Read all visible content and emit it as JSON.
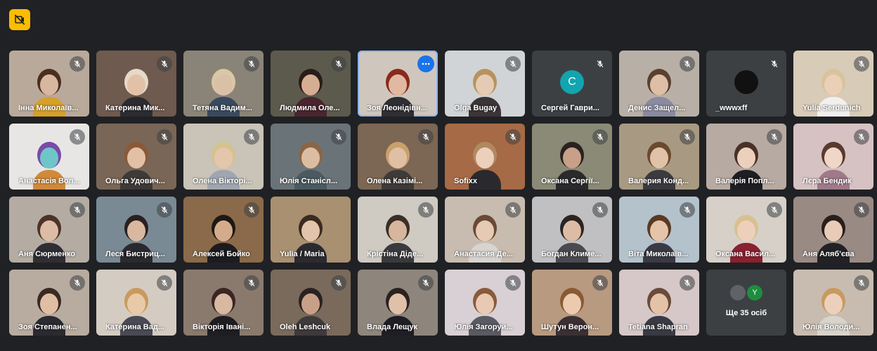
{
  "top_button_icon": "no-video-icon",
  "colors": {
    "background": "#202124",
    "tile": "#3c4043",
    "accent": "#8ab4f8",
    "button": "#fbbc04"
  },
  "participants": [
    {
      "name": "Інна Миколаїв...",
      "muted": true,
      "bg": "#b9a99a",
      "skin": "#d8b7a0",
      "hair": "#4a2e20",
      "shirt": "#d6a02a"
    },
    {
      "name": "Катерина Мик...",
      "muted": true,
      "bg": "#6e5a4e",
      "skin": "#e2c1a9",
      "hair": "#e6d9c8",
      "shirt": "#2c2c30"
    },
    {
      "name": "Тетяна Вадим...",
      "muted": true,
      "bg": "#8a8478",
      "skin": "#d9c0a6",
      "hair": "#d9c8a4",
      "shirt": "#3a4a5e"
    },
    {
      "name": "Людмила Оле...",
      "muted": true,
      "bg": "#5c5a4c",
      "skin": "#d4ad92",
      "hair": "#2a1c18",
      "shirt": "#4a2530"
    },
    {
      "name": "Зоя Леонідівн...",
      "muted": false,
      "active": true,
      "bg": "#cfc7bd",
      "skin": "#e0b9a0",
      "hair": "#8a2a1c",
      "shirt": "#2e2e34"
    },
    {
      "name": "Olga Bugay",
      "muted": true,
      "bg": "#d1d4d6",
      "skin": "#e6cbb4",
      "hair": "#b8925e",
      "shirt": "#3c3436"
    },
    {
      "name": "Сергей Гаври...",
      "muted": true,
      "avatar": "C",
      "avatar_color": "#12a4af"
    },
    {
      "name": "Денис Защел...",
      "muted": true,
      "bg": "#b8b0a6",
      "skin": "#dcbfa6",
      "hair": "#5a4030",
      "shirt": "#8a8aa0"
    },
    {
      "name": "_wwwxff",
      "muted": true,
      "avatar": "",
      "avatar_color": "#111111"
    },
    {
      "name": "Yulia Serdunich",
      "muted": true,
      "bg": "#d8cbb8",
      "skin": "#ebcfb6",
      "hair": "#d8c39c",
      "shirt": "#f2f0ee"
    },
    {
      "name": "Анастасія Вол...",
      "muted": true,
      "bg": "#e8e6e4",
      "skin": "#6ec6c8",
      "hair": "#7a4aa8",
      "shirt": "#d08a3a"
    },
    {
      "name": "Ольга Удович...",
      "muted": true,
      "bg": "#7a6656",
      "skin": "#e2c0a6",
      "hair": "#8a5a38",
      "shirt": "#3e3a38"
    },
    {
      "name": "Олена Вікторі...",
      "muted": true,
      "bg": "#c9c3b8",
      "skin": "#e4c6ad",
      "hair": "#d6c28e",
      "shirt": "#a0a6b0"
    },
    {
      "name": "Юлія Станісл...",
      "muted": true,
      "bg": "#6a7478",
      "skin": "#ddbda2",
      "hair": "#8a6646",
      "shirt": "#4a5a60"
    },
    {
      "name": "Олена Казімі...",
      "muted": true,
      "bg": "#7c6654",
      "skin": "#e0c0a4",
      "hair": "#c8a06a",
      "shirt": "#3e3a38"
    },
    {
      "name": "Sofixx",
      "muted": true,
      "bg": "#a66a46",
      "skin": "#ecd0bc",
      "hair": "#b08a5e",
      "shirt": "#2a2a2e"
    },
    {
      "name": "Оксана Сергії...",
      "muted": true,
      "bg": "#8a8a76",
      "skin": "#c8a088",
      "hair": "#2a2220",
      "shirt": "#2a2a2c"
    },
    {
      "name": "Валерия Конд...",
      "muted": true,
      "bg": "#a89a82",
      "skin": "#e0c2a8",
      "hair": "#6a4a2e",
      "shirt": "#3a3a40"
    },
    {
      "name": "Валерія Попл...",
      "muted": true,
      "bg": "#b6aaa2",
      "skin": "#ebd0bc",
      "hair": "#4a3026",
      "shirt": "#1e1e22"
    },
    {
      "name": "Лєра Бендик",
      "muted": true,
      "bg": "#d6c2c2",
      "skin": "#f0d6c6",
      "hair": "#5a3a2e",
      "shirt": "#a07a8a"
    },
    {
      "name": "Аня Сюрменко",
      "muted": true,
      "bg": "#b4aca2",
      "skin": "#dcbca4",
      "hair": "#4a3428",
      "shirt": "#2e2e34"
    },
    {
      "name": "Леся Бистриц...",
      "muted": true,
      "bg": "#7a8a94",
      "skin": "#d9b8a0",
      "hair": "#2a2020",
      "shirt": "#2a2a2e"
    },
    {
      "name": "Алексей Бойко",
      "muted": true,
      "bg": "#8a6a4a",
      "skin": "#d4ac8c",
      "hair": "#1e1814",
      "shirt": "#1c1c20"
    },
    {
      "name": "Yulia / Maria",
      "muted": false,
      "bg": "#a89070",
      "skin": "#e2c4aa",
      "hair": "#3a2a20",
      "shirt": "#2a2a30"
    },
    {
      "name": "Крістіна Діде...",
      "muted": true,
      "bg": "#cfcac2",
      "skin": "#d6b69c",
      "hair": "#3a2e28",
      "shirt": "#3a3a3e"
    },
    {
      "name": "Анастасия Де...",
      "muted": true,
      "bg": "#c8bcb0",
      "skin": "#e6cab4",
      "hair": "#6a4a34",
      "shirt": "#d8d4d0"
    },
    {
      "name": "Богдан Климе...",
      "muted": true,
      "bg": "#c0c0c2",
      "skin": "#dcbca4",
      "hair": "#2a2422",
      "shirt": "#4a4a50"
    },
    {
      "name": "Віта Миколаїв...",
      "muted": true,
      "bg": "#b4c2cc",
      "skin": "#e6c4aa",
      "hair": "#5a3a22",
      "shirt": "#3a3a44"
    },
    {
      "name": "Оксана Васил...",
      "muted": true,
      "bg": "#d6d0c8",
      "skin": "#ecd0bc",
      "hair": "#d8c090",
      "shirt": "#8a2030"
    },
    {
      "name": "Аня Аляб'єва",
      "muted": true,
      "bg": "#9a8a84",
      "skin": "#e8ccb8",
      "hair": "#2a1e1a",
      "shirt": "#222226"
    },
    {
      "name": "Зоя Степанен...",
      "muted": true,
      "bg": "#b8aca0",
      "skin": "#e0bea4",
      "hair": "#3a2a22",
      "shirt": "#2a2a30"
    },
    {
      "name": "Катерина Вад...",
      "muted": true,
      "bg": "#d4ccc2",
      "skin": "#e8caa8",
      "hair": "#c89a5e",
      "shirt": "#4a4a54"
    },
    {
      "name": "Вікторія Івані...",
      "muted": true,
      "bg": "#8a7a6e",
      "skin": "#d8b8a0",
      "hair": "#3a2622",
      "shirt": "#1e1e22"
    },
    {
      "name": "Oleh Leshcuk",
      "muted": true,
      "bg": "#7a6a5c",
      "skin": "#c8a088",
      "hair": "#2a2220",
      "shirt": "#3e3a3c"
    },
    {
      "name": "Влада Лещук",
      "muted": true,
      "bg": "#8e867c",
      "skin": "#e0c0a8",
      "hair": "#2a2220",
      "shirt": "#1e1e24"
    },
    {
      "name": "Юлія Загоруй...",
      "muted": true,
      "bg": "#d8d0d4",
      "skin": "#e8cab4",
      "hair": "#8a5a3a",
      "shirt": "#5a5a62"
    },
    {
      "name": "Шутун Верон...",
      "muted": true,
      "bg": "#b89a80",
      "skin": "#eccab0",
      "hair": "#8a5a32",
      "shirt": "#3a3034"
    },
    {
      "name": "Tetiana Shapran",
      "muted": true,
      "bg": "#d6c8c8",
      "skin": "#e4c2a8",
      "hair": "#6a4a38",
      "shirt": "#3a3a44"
    }
  ],
  "more": {
    "label": "Ще 35 осіб",
    "avatar_letter": "Y",
    "muted": false
  },
  "last": {
    "name": "Юлія Володи...",
    "muted": true,
    "bg": "#c8bcb0",
    "skin": "#ecd0bc",
    "hair": "#c89a5e",
    "shirt": "#d8d4cc"
  }
}
